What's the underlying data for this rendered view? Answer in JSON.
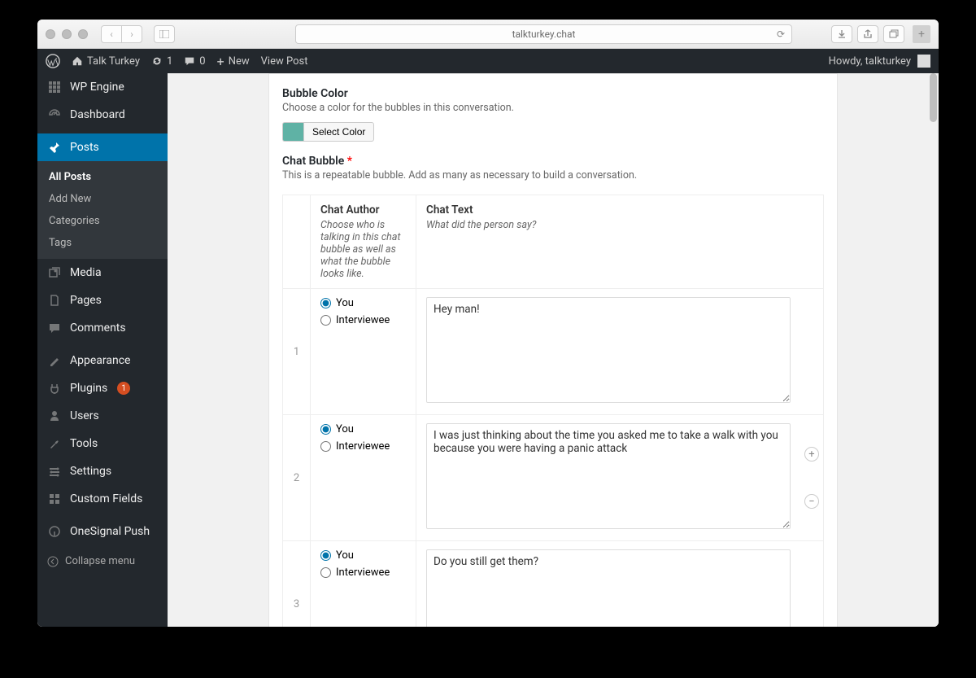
{
  "browser": {
    "url": "talkturkey.chat"
  },
  "adminbar": {
    "site_name": "Talk Turkey",
    "updates": "1",
    "comments": "0",
    "new_label": "New",
    "view_post": "View Post",
    "howdy": "Howdy, talkturkey"
  },
  "sidebar": {
    "wp_engine": "WP Engine",
    "dashboard": "Dashboard",
    "posts": "Posts",
    "posts_sub": {
      "all": "All Posts",
      "add": "Add New",
      "categories": "Categories",
      "tags": "Tags"
    },
    "media": "Media",
    "pages": "Pages",
    "comments": "Comments",
    "appearance": "Appearance",
    "plugins": "Plugins",
    "plugins_badge": "1",
    "users": "Users",
    "tools": "Tools",
    "settings": "Settings",
    "custom_fields": "Custom Fields",
    "onesignal": "OneSignal Push",
    "collapse": "Collapse menu"
  },
  "fields": {
    "bubble_color": {
      "label": "Bubble Color",
      "desc": "Choose a color for the bubbles in this conversation.",
      "button": "Select Color",
      "swatch": "#5fb2a5"
    },
    "chat_bubble": {
      "label": "Chat Bubble",
      "desc": "This is a repeatable bubble. Add as many as necessary to build a conversation.",
      "author_header": "Chat Author",
      "author_desc": "Choose who is talking in this chat bubble as well as what the bubble looks like.",
      "text_header": "Chat Text",
      "text_desc": "What did the person say?",
      "option_you": "You",
      "option_interviewee": "Interviewee",
      "rows": [
        {
          "num": "1",
          "author": "You",
          "text": "Hey man!"
        },
        {
          "num": "2",
          "author": "You",
          "text": "I was just thinking about the time you asked me to take a walk with you because you were having a panic attack"
        },
        {
          "num": "3",
          "author": "You",
          "text": "Do you still get them?"
        }
      ]
    }
  }
}
